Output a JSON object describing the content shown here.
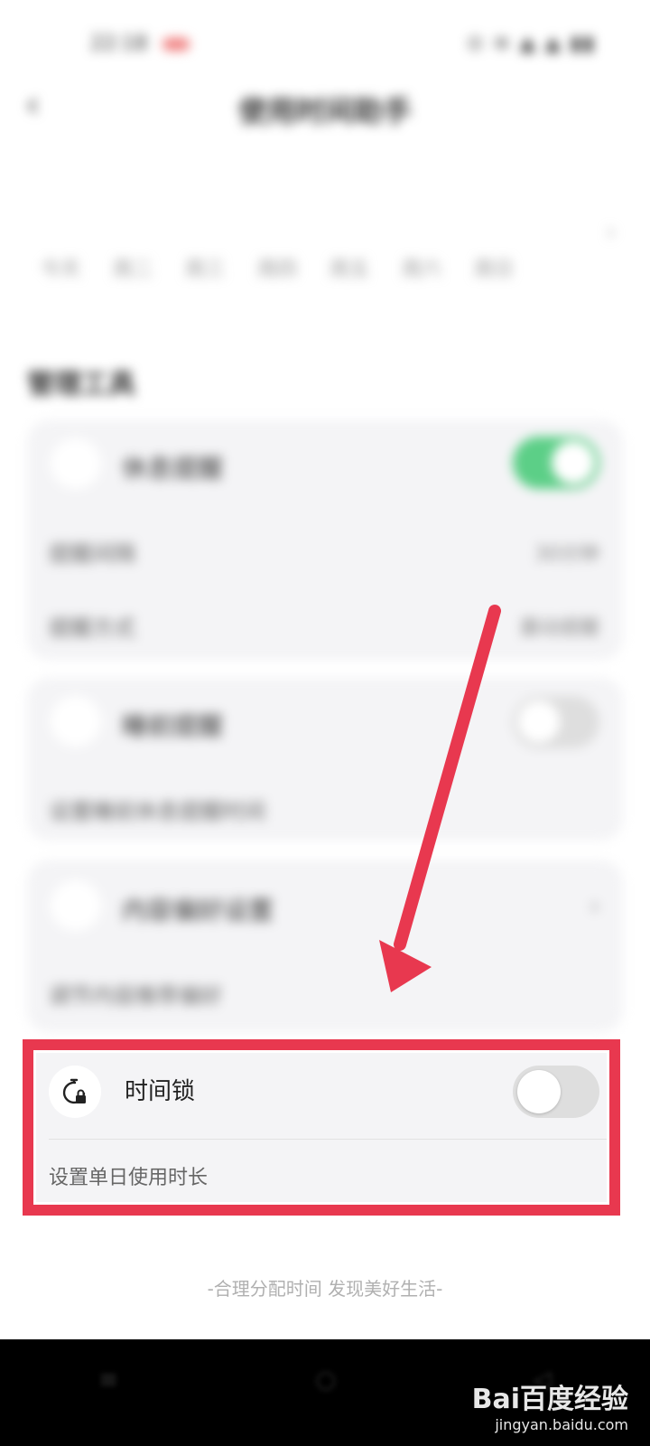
{
  "status_bar": {
    "time": "22:18",
    "icons": "⊙ ≋ ▲ ▲ ▮▮"
  },
  "header": {
    "title": "使用时间助手"
  },
  "week": {
    "days": [
      "今天",
      "周二",
      "周三",
      "周四",
      "周五",
      "周六",
      "周日"
    ]
  },
  "tools": {
    "section_title": "管理工具",
    "reminder": {
      "title": "休息提醒",
      "on": true,
      "rows": [
        {
          "label": "提醒间隔",
          "value": "30分钟"
        },
        {
          "label": "提醒方式",
          "value": "震动提醒"
        }
      ]
    },
    "sleep": {
      "title": "睡前提醒",
      "on": false,
      "subtitle": "设置睡前休息提醒时间"
    },
    "content": {
      "title": "内容偏好设置",
      "subtitle": "调节内容推荐偏好"
    }
  },
  "timelock": {
    "title": "时间锁",
    "subtitle": "设置单日使用时长",
    "on": false
  },
  "footer": {
    "tagline": "-合理分配时间 发现美好生活-"
  },
  "watermark": {
    "brand": "Bai百度经验",
    "url": "jingyan.baidu.com"
  },
  "colors": {
    "highlight": "#e8384f",
    "toggle_on": "#5ccf87",
    "toggle_off": "#dedede"
  }
}
